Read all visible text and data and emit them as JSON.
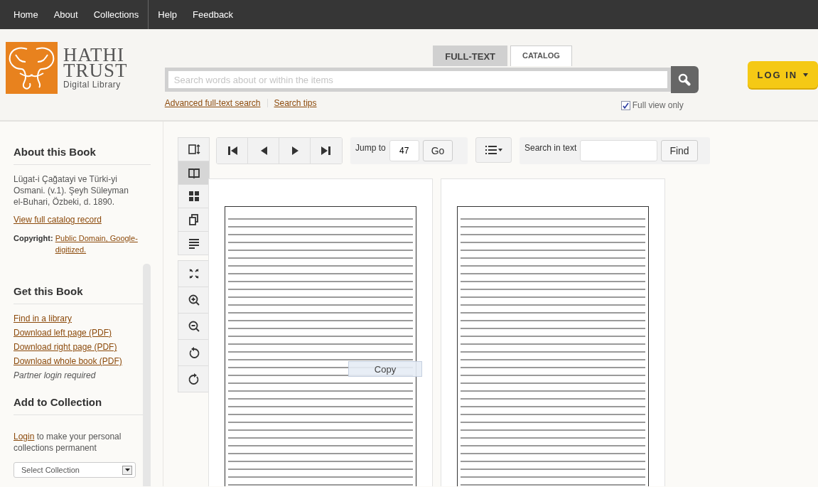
{
  "nav": {
    "primary": [
      {
        "label": "Home"
      },
      {
        "label": "About"
      },
      {
        "label": "Collections"
      }
    ],
    "secondary": [
      {
        "label": "Help"
      },
      {
        "label": "Feedback"
      }
    ]
  },
  "header": {
    "logo": {
      "line_1": "HATHI",
      "line_2": "TRUST",
      "line_3": "Digital Library"
    },
    "search_tabs": [
      {
        "label": "FULL-TEXT",
        "selected": true
      },
      {
        "label": "CATALOG",
        "selected": false
      }
    ],
    "search": {
      "placeholder": "Search words about or within the items"
    },
    "links": [
      "Advanced full-text search",
      "Search tips"
    ],
    "full_view_only": {
      "label": "Full view only",
      "checked": true
    },
    "login": {
      "label": "LOG IN"
    }
  },
  "sidebar": {
    "about": {
      "title": "About this Book",
      "description": "Lügat-i Çağatayi ve Türki-yi Osmani. (v.1). Şeyh Süleyman el-Buhari, Özbeki, d. 1890.",
      "catalog_link": "View full catalog record",
      "copyright_label": "Copyright:",
      "copyright_link": "Public Domain, Google-digitized."
    },
    "get": {
      "title": "Get this Book",
      "links": [
        "Find in a library",
        "Download left page (PDF)",
        "Download right page (PDF)",
        "Download whole book (PDF)"
      ],
      "note": "Partner login required"
    },
    "collection": {
      "title": "Add to Collection",
      "login_link": "Login",
      "text": " to make your personal collections permanent",
      "select": "Select Collection"
    }
  },
  "viewer": {
    "view_modes": [
      {
        "kind": "scroll",
        "selected": false
      },
      {
        "kind": "flip",
        "selected": true
      },
      {
        "kind": "thumbnails",
        "selected": false
      },
      {
        "kind": "page",
        "selected": false
      },
      {
        "kind": "text",
        "selected": false
      }
    ],
    "tools": [
      {
        "kind": "fullscreen"
      },
      {
        "kind": "zoom-in"
      },
      {
        "kind": "zoom-out"
      },
      {
        "kind": "rotate-left"
      },
      {
        "kind": "rotate-right"
      }
    ],
    "paging": [
      {
        "kind": "first"
      },
      {
        "kind": "previous"
      },
      {
        "kind": "next"
      },
      {
        "kind": "last"
      }
    ],
    "jump": {
      "label": "Jump to",
      "value": "47",
      "button": "Go"
    },
    "search": {
      "label": "Search in text",
      "button": "Find"
    },
    "popup": {
      "label": "Copy"
    }
  }
}
